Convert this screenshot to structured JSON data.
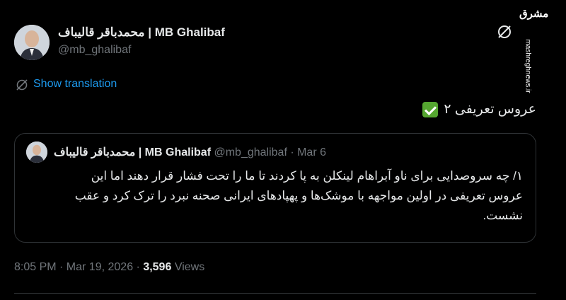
{
  "author": {
    "display_name": "محمدباقر قالیباف | MB Ghalibaf",
    "handle": "@mb_ghalibaf"
  },
  "watermark": {
    "logo_text": "مشرق",
    "url": "mashreghnews.ir"
  },
  "translation": {
    "label": "Show translation"
  },
  "tweet": {
    "text": "عروس تعریفی ۲",
    "emoji": "check-mark-button"
  },
  "quoted": {
    "display_name": "محمدباقر قالیباف | MB Ghalibaf",
    "meta": "@mb_ghalibaf · Mar 6",
    "lines": [
      "۱/ چه سروصدایی برای ناو آبراهام لینکلن به پا کردند تا ما را تحت فشار قرار دهند اما این",
      "عروس تعریفی در اولین مواجهه با موشک‌ها و پهپادهای ایرانی صحنه نبرد را ترک کرد و عقب",
      "نشست."
    ]
  },
  "meta": {
    "timestamp": "8:05 PM · Mar 19, 2026",
    "separator": " · ",
    "views_count": "3,596",
    "views_label": "Views"
  }
}
